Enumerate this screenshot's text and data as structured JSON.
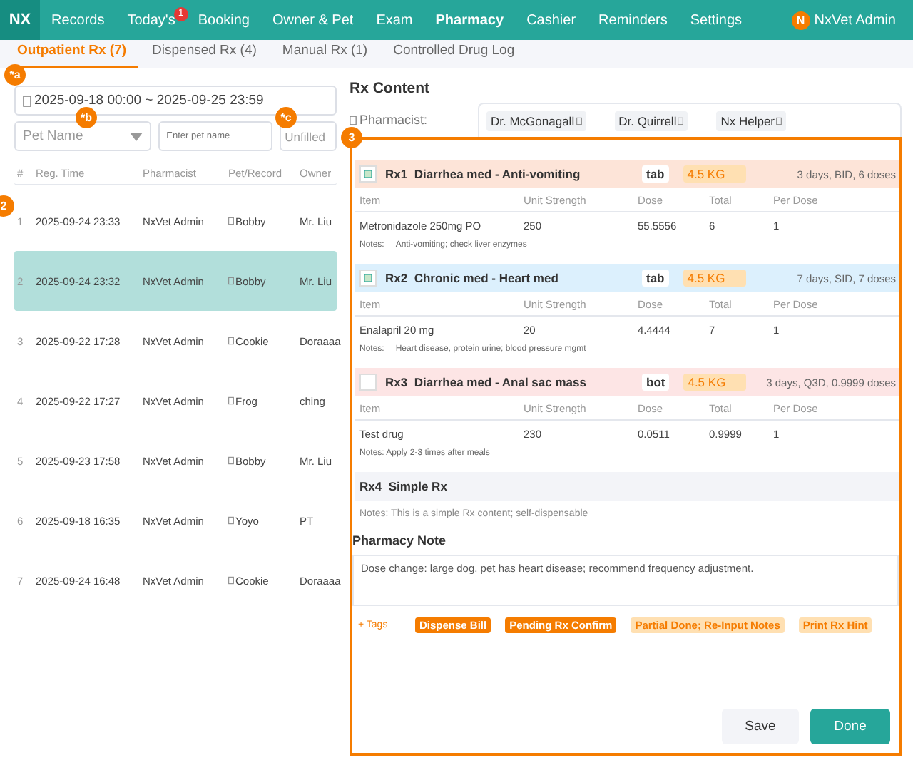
{
  "nav": {
    "logo": "NX",
    "items": [
      {
        "label": "Records",
        "selected": false
      },
      {
        "label": "Today's",
        "selected": false,
        "badge": "1"
      },
      {
        "label": "Booking",
        "selected": false
      },
      {
        "label": "Owner & Pet",
        "selected": false
      },
      {
        "label": "Exam",
        "selected": false
      },
      {
        "label": "Pharmacy",
        "selected": true
      },
      {
        "label": "Cashier",
        "selected": false
      },
      {
        "label": "Reminders",
        "selected": false
      },
      {
        "label": "Settings",
        "selected": false
      }
    ],
    "user": {
      "avatar": "N",
      "name": "NxVet Admin"
    }
  },
  "tabs": [
    {
      "label": "Outpatient Rx (7)",
      "selected": true
    },
    {
      "label": "Dispensed Rx (4)",
      "selected": false
    },
    {
      "label": "Manual Rx (1)",
      "selected": false
    },
    {
      "label": "Controlled Drug Log",
      "selected": false
    }
  ],
  "filters": {
    "date_range": "2025-09-18 00:00 ~ 2025-09-25 23:59",
    "pet_select": {
      "placeholder": "Pet Name"
    },
    "pet_input": {
      "placeholder": "Enter pet name"
    },
    "status_select": {
      "value": "Unfilled"
    }
  },
  "markers": [
    {
      "label": "*a"
    },
    {
      "label": "*b"
    },
    {
      "label": "*c"
    },
    {
      "label": "2"
    },
    {
      "label": "3"
    }
  ],
  "table": {
    "columns": [
      "#",
      "Reg. Time",
      "Pharmacist",
      "Pet/Record",
      "Owner"
    ],
    "rows": [
      {
        "cells": [
          "1",
          "2025-09-24 23:33",
          "NxVet Admin",
          "Bobby",
          "Mr. Liu"
        ],
        "selected": false
      },
      {
        "cells": [
          "2",
          "2025-09-24 23:32",
          "NxVet Admin",
          "Bobby",
          "Mr. Liu"
        ],
        "selected": true
      },
      {
        "cells": [
          "3",
          "2025-09-22 17:28",
          "NxVet Admin",
          "Cookie",
          "Doraaaa"
        ],
        "selected": false
      },
      {
        "cells": [
          "4",
          "2025-09-22 17:27",
          "NxVet Admin",
          "Frog",
          "ching"
        ],
        "selected": false
      },
      {
        "cells": [
          "5",
          "2025-09-23 17:58",
          "NxVet Admin",
          "Bobby",
          "Mr. Liu"
        ],
        "selected": false
      },
      {
        "cells": [
          "6",
          "2025-09-18 16:35",
          "NxVet Admin",
          "Yoyo",
          "PT"
        ],
        "selected": false
      },
      {
        "cells": [
          "7",
          "2025-09-24 16:48",
          "NxVet Admin",
          "Cookie",
          "Doraaaa"
        ],
        "selected": false
      }
    ]
  },
  "rx_content": {
    "title": "Rx Content",
    "pharmacist_label": "Pharmacist:",
    "pharmacists": [
      "Dr. McGonagall",
      "Dr. Quirrell",
      "Nx Helper"
    ],
    "prescriptions": [
      {
        "kind": "table",
        "number": "Rx1",
        "title": "Diarrhea med - Anti-vomiting",
        "color": "#fde4d8",
        "checked": true,
        "form": "tab",
        "weight": "4.5 KG",
        "schedule": "3 days, BID, 6 doses",
        "columns": [
          "Item",
          "Unit Strength",
          "Dose",
          "Total",
          "Per Dose"
        ],
        "items": [
          [
            "Metronidazole 250mg PO",
            "250",
            "55.5556",
            "6",
            "1"
          ]
        ],
        "notes_label": "Notes:",
        "notes": "Anti-vomiting; check liver enzymes"
      },
      {
        "kind": "table",
        "number": "Rx2",
        "title": "Chronic med - Heart med",
        "color": "#dcf0fd",
        "checked": true,
        "form": "tab",
        "weight": "4.5 KG",
        "schedule": "7 days, SID, 7 doses",
        "columns": [
          "Item",
          "Unit Strength",
          "Dose",
          "Total",
          "Per Dose"
        ],
        "items": [
          [
            "Enalapril 20 mg",
            "20",
            "4.4444",
            "7",
            "1"
          ]
        ],
        "notes_label": "Notes:",
        "notes": "Heart disease, protein urine; blood pressure mgmt"
      },
      {
        "kind": "table",
        "number": "Rx3",
        "title": "Diarrhea med - Anal sac mass",
        "color": "#fde5e5",
        "checked": false,
        "form": "bot",
        "weight": "4.5 KG",
        "schedule": "3 days, Q3D, 0.9999 doses",
        "columns": [
          "Item",
          "Unit Strength",
          "Dose",
          "Total",
          "Per Dose"
        ],
        "items": [
          [
            "Test drug",
            "230",
            "0.0511",
            "0.9999",
            "1"
          ]
        ],
        "notes": "Notes: Apply 2-3 times after meals"
      },
      {
        "kind": "simple",
        "number": "Rx4",
        "title": "Simple Rx",
        "color": "#f3f4f8",
        "notes": "Notes: This is a simple Rx content; self-dispensable"
      }
    ]
  },
  "pharmacy_note": {
    "title": "Pharmacy Note",
    "value": "Dose change: large dog, pet has heart disease; recommend frequency adjustment."
  },
  "tags": {
    "add": "+ Tags",
    "items": [
      {
        "label": "Dispense Bill",
        "selected": true
      },
      {
        "label": "Pending Rx Confirm",
        "selected": true
      },
      {
        "label": "Partial Done; Re-Input Notes",
        "selected": false
      },
      {
        "label": "Print Rx Hint",
        "selected": false
      }
    ]
  },
  "buttons": [
    {
      "label": "Save",
      "kind": "secondary"
    },
    {
      "label": "Done",
      "kind": "primary"
    }
  ]
}
